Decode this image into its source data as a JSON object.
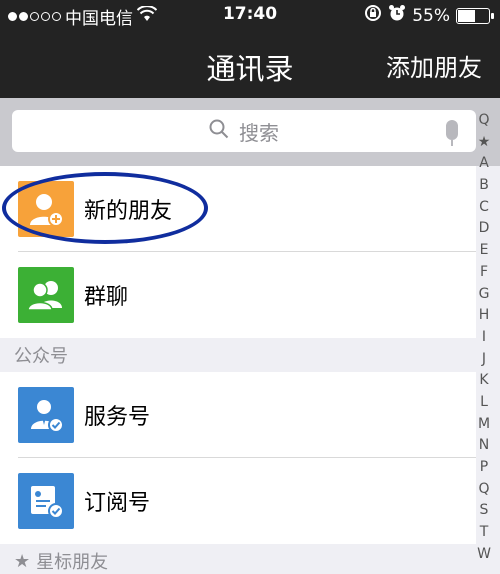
{
  "status": {
    "carrier": "中国电信",
    "time": "17:40",
    "battery": "55%",
    "battery_level": 55
  },
  "nav": {
    "title": "通讯录",
    "add_friend": "添加朋友"
  },
  "search": {
    "placeholder": "搜索"
  },
  "rows": {
    "new_friends": "新的朋友",
    "group_chat": "群聊",
    "service": "服务号",
    "subscription": "订阅号"
  },
  "sections": {
    "official": "公众号",
    "starred": "星标朋友",
    "star_icon": "★"
  },
  "index": [
    "Q",
    "★",
    "A",
    "B",
    "C",
    "D",
    "E",
    "F",
    "G",
    "H",
    "I",
    "J",
    "K",
    "L",
    "M",
    "N",
    "P",
    "Q",
    "S",
    "T",
    "W"
  ],
  "colors": {
    "bar_bg": "#232323",
    "new_friends_avatar": "#f7a23a",
    "group_avatar": "#3cb035",
    "service_avatar": "#3b87d3",
    "subscription_avatar": "#3b87d3",
    "highlight_ring": "#102d9e"
  }
}
